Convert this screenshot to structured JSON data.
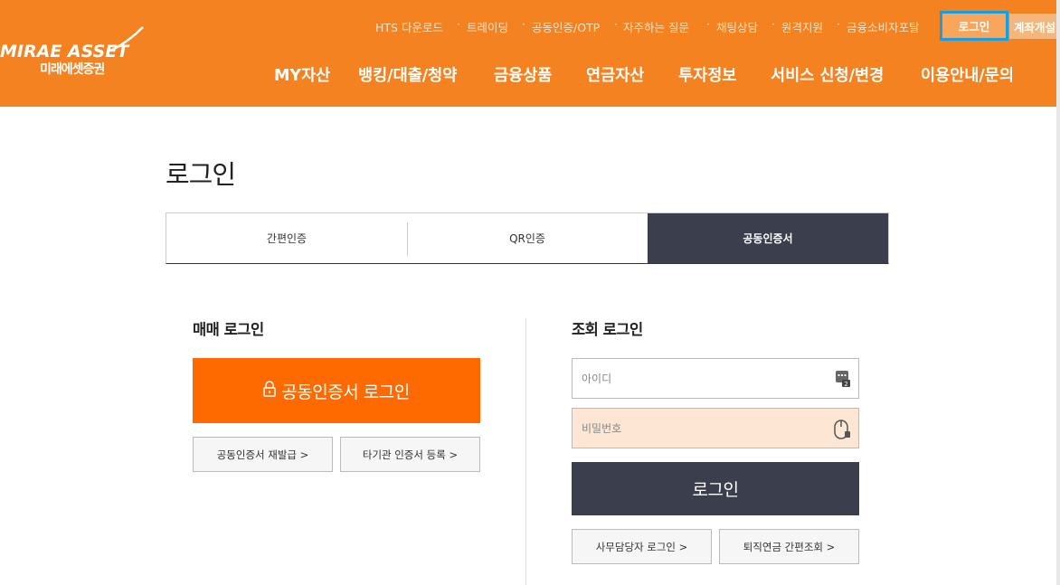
{
  "header": {
    "logo_en": "MIRAE ASSET",
    "logo_ko": "미래에셋증권",
    "util_links": [
      "HTS 다운로드",
      "트레이딩",
      "공동인증/OTP",
      "자주하는 질문",
      "채팅상담",
      "원격지원",
      "금융소비자포탈"
    ],
    "util_login": "로그인",
    "util_open_account": "계좌개설",
    "gnb": [
      "MY자산",
      "뱅킹/대출/청약",
      "금융상품",
      "연금자산",
      "투자정보",
      "서비스 신청/변경",
      "이용안내/문의"
    ],
    "colors": {
      "brand": "#f58220",
      "highlight": "#1a9ce0"
    }
  },
  "page": {
    "title": "로그인"
  },
  "tabs": [
    {
      "label": "간편인증",
      "active": false
    },
    {
      "label": "QR인증",
      "active": false
    },
    {
      "label": "공동인증서",
      "active": true
    }
  ],
  "trade_login": {
    "title": "매매 로그인",
    "cert_button": "공동인증서 로그인",
    "reissue_button": "공동인증서 재발급 >",
    "register_button": "타기관 인증서 등록 >",
    "button_color": "#ff6a00"
  },
  "inquiry_login": {
    "title": "조회 로그인",
    "id_placeholder": "아이디",
    "pw_placeholder": "비밀번호",
    "login_button": "로그인",
    "staff_button": "사무담당자 로그인 >",
    "pension_button": "퇴직연금 간편조회 >",
    "id_icon": "keypad-icon",
    "pw_icon": "mouse-icon"
  }
}
